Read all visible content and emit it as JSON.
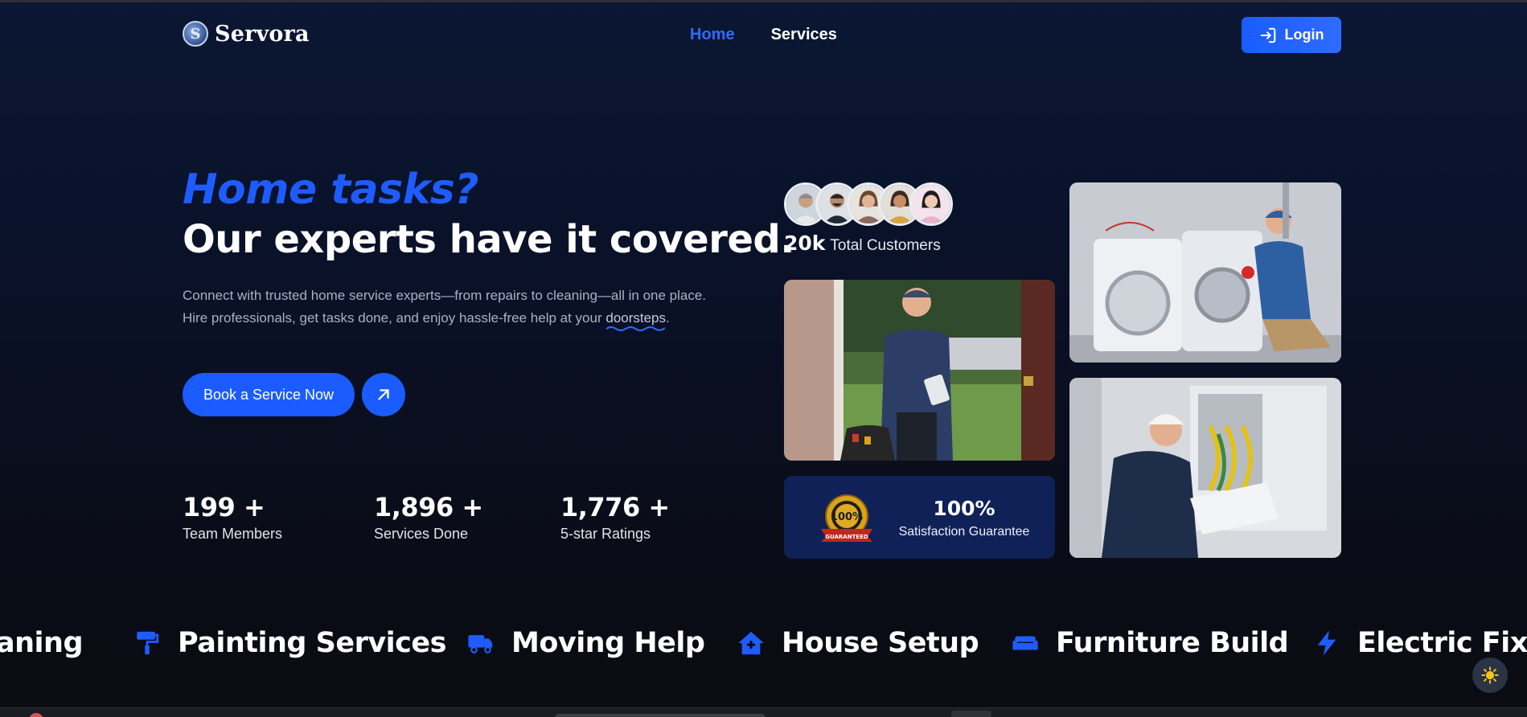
{
  "header": {
    "logo_letter": "S",
    "logo_text": "Servora",
    "nav": [
      {
        "label": "Home",
        "active": true
      },
      {
        "label": "Services",
        "active": false
      }
    ],
    "login_label": "Login"
  },
  "hero": {
    "kicker": "Home tasks?",
    "title": "Our experts have it covered.",
    "desc_line1": "Connect with trusted home service experts—from repairs to cleaning—all in one place.",
    "desc_line2_pre": "Hire professionals, get tasks done, and enjoy hassle-free help at your ",
    "desc_line2_word": "doorsteps",
    "desc_line2_post": ".",
    "cta_label": "Book a Service Now"
  },
  "stats": [
    {
      "value": "199 +",
      "label": "Team Members"
    },
    {
      "value": "1,896 +",
      "label": "Services Done"
    },
    {
      "value": "1,776 +",
      "label": "5-star Ratings"
    }
  ],
  "customers": {
    "count": "20k",
    "label": "Total Customers"
  },
  "guarantee": {
    "value": "100%",
    "label": "Satisfaction Guarantee",
    "seal_top": "100%",
    "seal_ribbon": "GUARANTEED"
  },
  "marquee": [
    {
      "label": "aning",
      "icon": "cleaning-icon"
    },
    {
      "label": "Painting Services",
      "icon": "paint-roller-icon"
    },
    {
      "label": "Moving Help",
      "icon": "truck-icon"
    },
    {
      "label": "House Setup",
      "icon": "house-icon"
    },
    {
      "label": "Furniture Build",
      "icon": "sofa-icon"
    },
    {
      "label": "Electric Fixes",
      "icon": "bolt-icon"
    }
  ],
  "colors": {
    "accent": "#1a5cff",
    "accent_text": "#2f6bff",
    "card_bg": "#0f2157"
  }
}
